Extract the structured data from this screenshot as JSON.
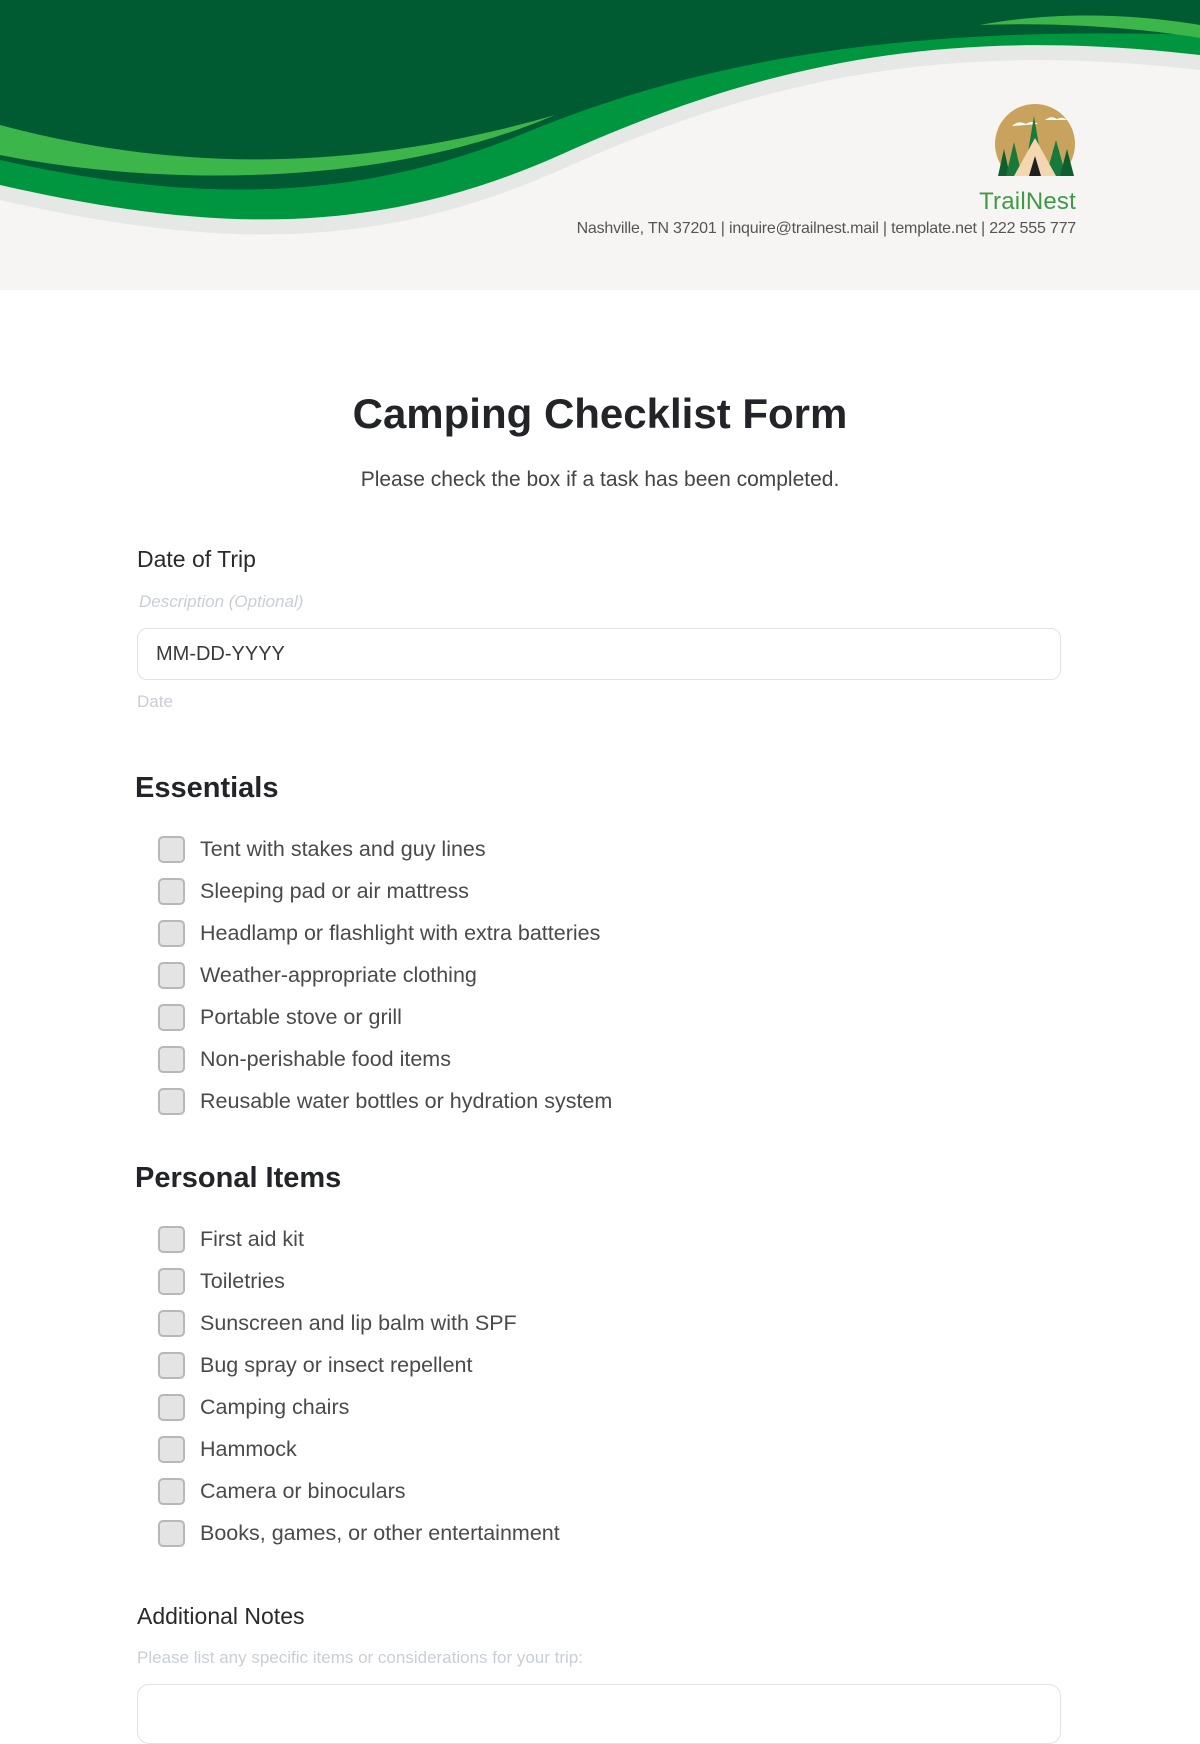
{
  "header": {
    "brand_name": "TrailNest",
    "contact_line": "Nashville, TN 37201 | inquire@trailnest.mail | template.net | 222 555 777",
    "colors": {
      "dark_green": "#005a32",
      "mid_green": "#00963f",
      "light_green": "#3cb54a",
      "brand_text": "#3f9a46",
      "logo_gold": "#c9a25e"
    },
    "logo_icon": "tent-forest-logo-icon"
  },
  "form": {
    "title": "Camping Checklist Form",
    "subtitle": "Please check the box if a task has been completed.",
    "date_field": {
      "label": "Date of Trip",
      "description": "Description (Optional)",
      "placeholder": "MM-DD-YYYY",
      "helper": "Date"
    },
    "sections": [
      {
        "title": "Essentials",
        "items": [
          {
            "label": "Tent with stakes and guy lines",
            "checked": false
          },
          {
            "label": "Sleeping pad or air mattress",
            "checked": false
          },
          {
            "label": "Headlamp or flashlight with extra batteries",
            "checked": false
          },
          {
            "label": "Weather-appropriate clothing",
            "checked": false
          },
          {
            "label": "Portable stove or grill",
            "checked": false
          },
          {
            "label": "Non-perishable food items",
            "checked": false
          },
          {
            "label": "Reusable water bottles or hydration system",
            "checked": false
          }
        ]
      },
      {
        "title": "Personal Items",
        "items": [
          {
            "label": "First aid kit",
            "checked": false
          },
          {
            "label": "Toiletries",
            "checked": false
          },
          {
            "label": "Sunscreen and lip balm with SPF",
            "checked": false
          },
          {
            "label": "Bug spray or insect repellent",
            "checked": false
          },
          {
            "label": "Camping chairs",
            "checked": false
          },
          {
            "label": "Hammock",
            "checked": false
          },
          {
            "label": "Camera or binoculars",
            "checked": false
          },
          {
            "label": "Books, games, or other entertainment",
            "checked": false
          }
        ]
      }
    ],
    "notes_field": {
      "label": "Additional Notes",
      "hint": "Please list any specific items or considerations for your trip:",
      "value": ""
    }
  }
}
